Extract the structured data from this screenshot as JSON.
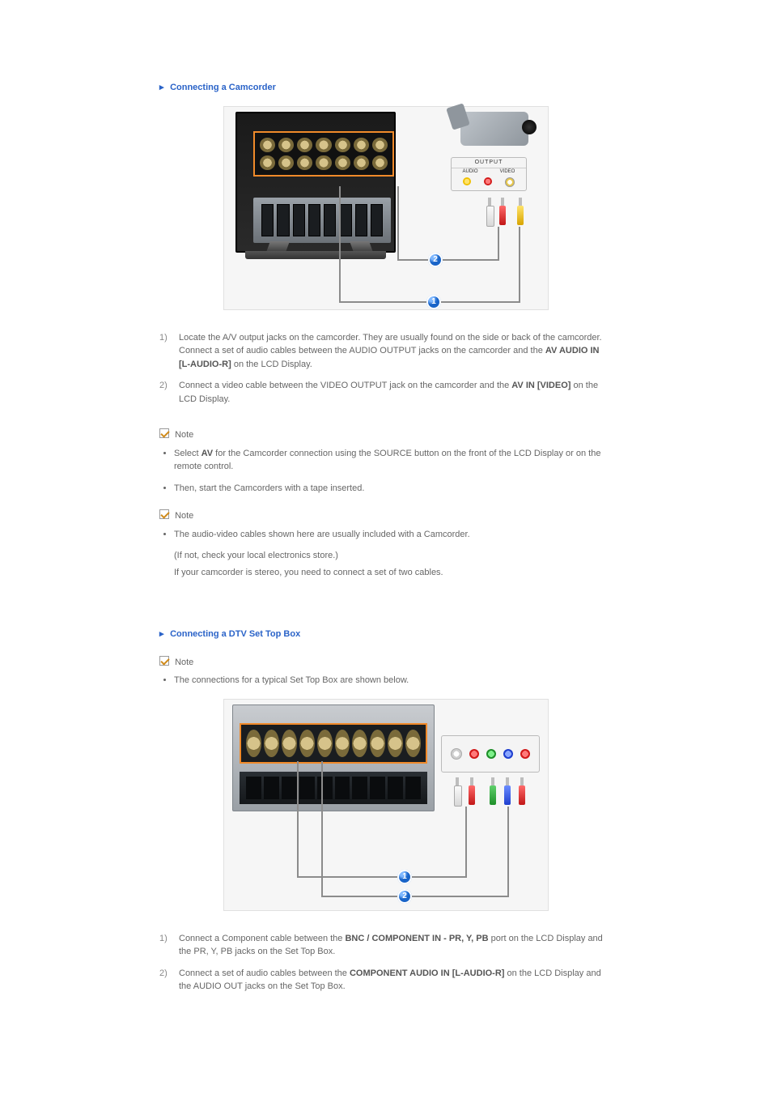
{
  "section1": {
    "title": "Connecting a Camcorder",
    "figure_alt": "LCD Display rear panel connected to a camcorder via A/V cables; audio cable labeled 2, video cable labeled 1.",
    "output_label": "OUTPUT",
    "output_audio": "AUDIO",
    "output_video": "VIDEO",
    "badge1": "1",
    "badge2": "2",
    "steps": [
      {
        "index": "1)",
        "lines": {
          "a": "Locate the A/V output jacks on the camcorder. They are usually found on the side or back of the camcorder.",
          "b_pre": "Connect a set of audio cables between the AUDIO OUTPUT jacks on the camcorder and the ",
          "b_bold": "AV AUDIO IN [L-AUDIO-R]",
          "b_post": " on the LCD Display."
        }
      },
      {
        "index": "2)",
        "lines": {
          "a_pre": "Connect a video cable between the VIDEO OUTPUT jack on the camcorder and the ",
          "a_bold": "AV IN [VIDEO]",
          "a_post": " on the LCD Display."
        }
      }
    ],
    "note1_label": "Note",
    "note1_items": {
      "a_pre": "Select ",
      "a_bold": "AV",
      "a_post": " for the Camcorder connection using the SOURCE button on the front of the LCD Display or on the remote control.",
      "b": "Then, start the Camcorders with a tape inserted."
    },
    "note2_label": "Note",
    "note2_items": {
      "a": "The audio-video cables shown here are usually included with a Camcorder.",
      "a_sub1": "(If not, check your local electronics store.)",
      "a_sub2": "If your camcorder is stereo, you need to connect a set of two cables."
    }
  },
  "section2": {
    "title": "Connecting a DTV Set Top Box",
    "note_label": "Note",
    "note_item": "The connections for a typical Set Top Box are shown below.",
    "figure_alt": "LCD Display rear panel connected to a Set Top Box via component video (labeled 2) and audio (labeled 1) cables.",
    "badge1": "1",
    "badge2": "2",
    "steps": [
      {
        "index": "1)",
        "lines": {
          "pre": "Connect a Component cable between the ",
          "bold": "BNC / COMPONENT IN - PR, Y, PB",
          "mid": " port on the LCD Display and the P",
          "r": "R",
          "mid2": ", Y, P",
          "b": "B",
          "post": " jacks on the Set Top Box."
        }
      },
      {
        "index": "2)",
        "lines": {
          "pre": "Connect a set of audio cables between the ",
          "bold": "COMPONENT AUDIO IN [L-AUDIO-R]",
          "post": " on the LCD Display and the AUDIO OUT jacks on the Set Top Box."
        }
      }
    ]
  }
}
